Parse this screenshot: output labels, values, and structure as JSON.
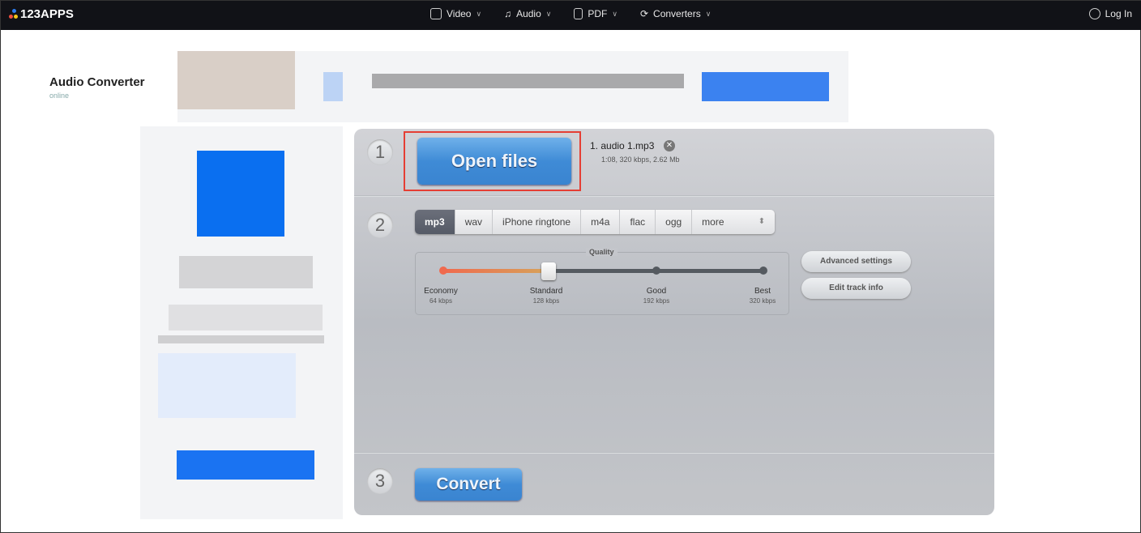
{
  "header": {
    "brand": "123APPS",
    "nav": [
      {
        "label": "Video",
        "icon": "video-icon"
      },
      {
        "label": "Audio",
        "icon": "music-icon"
      },
      {
        "label": "PDF",
        "icon": "pdf-icon"
      },
      {
        "label": "Converters",
        "icon": "converters-icon"
      }
    ],
    "login": "Log In"
  },
  "app": {
    "title": "Audio Converter",
    "subtitle": "online"
  },
  "steps": {
    "one": "1",
    "two": "2",
    "three": "3"
  },
  "open_files": "Open files",
  "file": {
    "name": "1. audio 1.mp3",
    "info": "1:08, 320 kbps, 2.62 Mb"
  },
  "formats": [
    "mp3",
    "wav",
    "iPhone ringtone",
    "m4a",
    "flac",
    "ogg",
    "more"
  ],
  "selected_format": "mp3",
  "quality": {
    "label": "Quality",
    "value_kbps": 128,
    "levels": [
      {
        "name": "Economy",
        "rate": "64 kbps"
      },
      {
        "name": "Standard",
        "rate": "128 kbps"
      },
      {
        "name": "Good",
        "rate": "192 kbps"
      },
      {
        "name": "Best",
        "rate": "320 kbps"
      }
    ]
  },
  "advanced_settings": "Advanced settings",
  "edit_track_info": "Edit track info",
  "convert": "Convert",
  "colors": {
    "accent": "#3f8bd6",
    "highlight": "#e53e34",
    "topbar": "#111217"
  }
}
